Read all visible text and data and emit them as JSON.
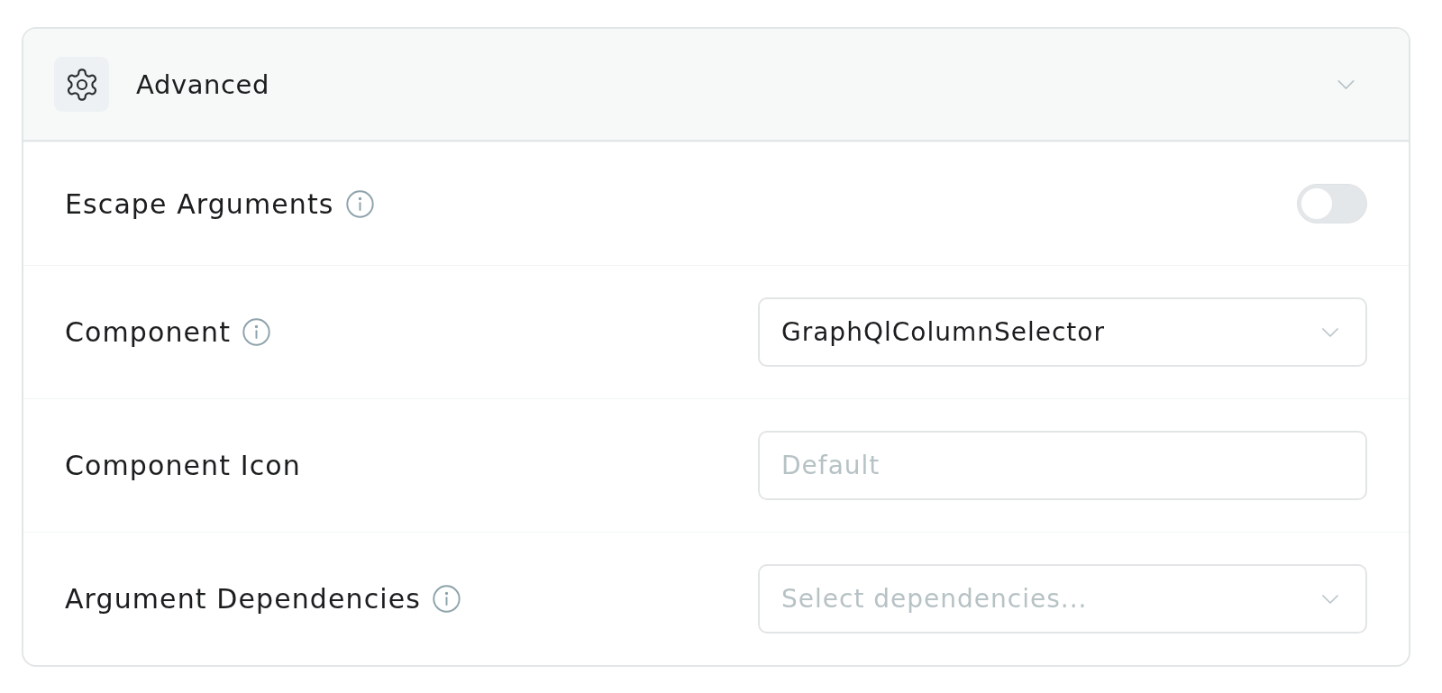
{
  "section": {
    "title": "Advanced",
    "expanded": true
  },
  "rows": [
    {
      "kind": "toggle",
      "label": "Escape Arguments",
      "info": true,
      "on": false
    },
    {
      "kind": "select",
      "label": "Component",
      "info": true,
      "value": "GraphQlColumnSelector"
    },
    {
      "kind": "input",
      "label": "Component Icon",
      "info": false,
      "placeholder": "Default"
    },
    {
      "kind": "select",
      "label": "Argument Dependencies",
      "info": true,
      "placeholder": "Select dependencies..."
    }
  ]
}
